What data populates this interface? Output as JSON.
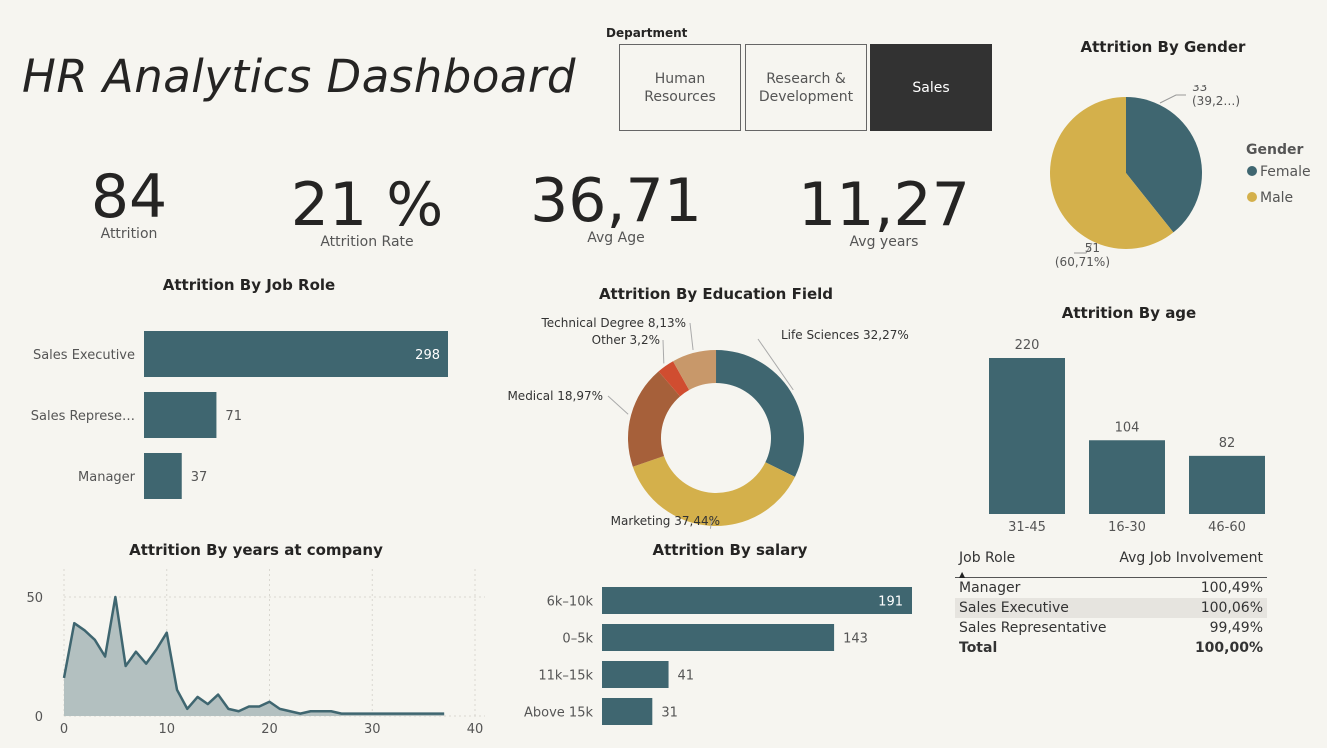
{
  "title": "HR Analytics Dashboard",
  "slicer": {
    "label": "Department",
    "options": [
      "Human Resources",
      "Research & Development",
      "Sales"
    ],
    "selected": "Sales"
  },
  "kpis": [
    {
      "value": "84",
      "label": "Attrition"
    },
    {
      "value": "21 %",
      "label": "Attrition Rate"
    },
    {
      "value": "36,71",
      "label": "Avg Age"
    },
    {
      "value": "11,27",
      "label": "Avg years"
    }
  ],
  "colors": {
    "teal": "#3f6670",
    "gold": "#d4b04b",
    "brown": "#a6603a",
    "orange_red": "#d04d30",
    "tan": "#c8986a",
    "area_fill": "#b3c0c0"
  },
  "chart_data": [
    {
      "type": "pie",
      "title": "Attrition By Gender",
      "legend_title": "Gender",
      "legend_position": "right",
      "slices": [
        {
          "name": "Female",
          "value": 33,
          "label_lines": [
            "33",
            "(39,2…)"
          ]
        },
        {
          "name": "Male",
          "value": 51,
          "label_lines": [
            "51",
            "(60,71%)"
          ]
        }
      ]
    },
    {
      "type": "bar",
      "orientation": "horizontal",
      "title": "Attrition By Job Role",
      "categories": [
        "Sales Executive",
        "Sales Represe…",
        "Manager"
      ],
      "values": [
        298,
        71,
        37
      ]
    },
    {
      "type": "pie",
      "subtype": "donut",
      "title": "Attrition By Education Field",
      "slices": [
        {
          "name": "Life Sciences",
          "percent": 32.27,
          "label": "Life Sciences 32,27%"
        },
        {
          "name": "Marketing",
          "percent": 37.44,
          "label": "Marketing 37,44%"
        },
        {
          "name": "Medical",
          "percent": 18.97,
          "label": "Medical 18,97%"
        },
        {
          "name": "Other",
          "percent": 3.2,
          "label": "Other 3,2%"
        },
        {
          "name": "Technical Degree",
          "percent": 8.13,
          "label": "Technical Degree 8,13%"
        }
      ]
    },
    {
      "type": "bar",
      "title": "Attrition By age",
      "categories": [
        "31-45",
        "16-30",
        "46-60"
      ],
      "values": [
        220,
        104,
        82
      ]
    },
    {
      "type": "area",
      "title": "Attrition By years at company",
      "x": [
        0,
        1,
        2,
        3,
        4,
        5,
        6,
        7,
        8,
        9,
        10,
        11,
        12,
        13,
        14,
        15,
        16,
        17,
        18,
        19,
        20,
        21,
        22,
        23,
        24,
        25,
        26,
        27,
        28,
        29,
        30,
        31,
        32,
        33,
        34,
        35,
        36,
        37
      ],
      "values": [
        16,
        39,
        36,
        32,
        25,
        50,
        21,
        27,
        22,
        28,
        35,
        11,
        3,
        8,
        5,
        9,
        3,
        2,
        4,
        4,
        6,
        3,
        2,
        1,
        2,
        2,
        2,
        1,
        1,
        1,
        1,
        1,
        1,
        1,
        1,
        1,
        1,
        1
      ],
      "xlim": [
        0,
        40
      ],
      "ylim": [
        0,
        50
      ],
      "xticks": [
        "0",
        "10",
        "20",
        "30",
        "40"
      ],
      "yticks": [
        "0",
        "50"
      ],
      "grid": true
    },
    {
      "type": "bar",
      "orientation": "horizontal",
      "title": "Attrition By salary",
      "categories": [
        "6k–10k",
        "0–5k",
        "11k–15k",
        "Above 15k"
      ],
      "values": [
        191,
        143,
        41,
        31
      ]
    },
    {
      "type": "table",
      "columns": [
        "Job Role",
        "Avg Job Involvement"
      ],
      "rows": [
        [
          "Manager",
          "100,49%"
        ],
        [
          "Sales Executive",
          "100,06%"
        ],
        [
          "Sales Representative",
          "99,49%"
        ]
      ],
      "total": [
        "Total",
        "100,00%"
      ]
    }
  ]
}
